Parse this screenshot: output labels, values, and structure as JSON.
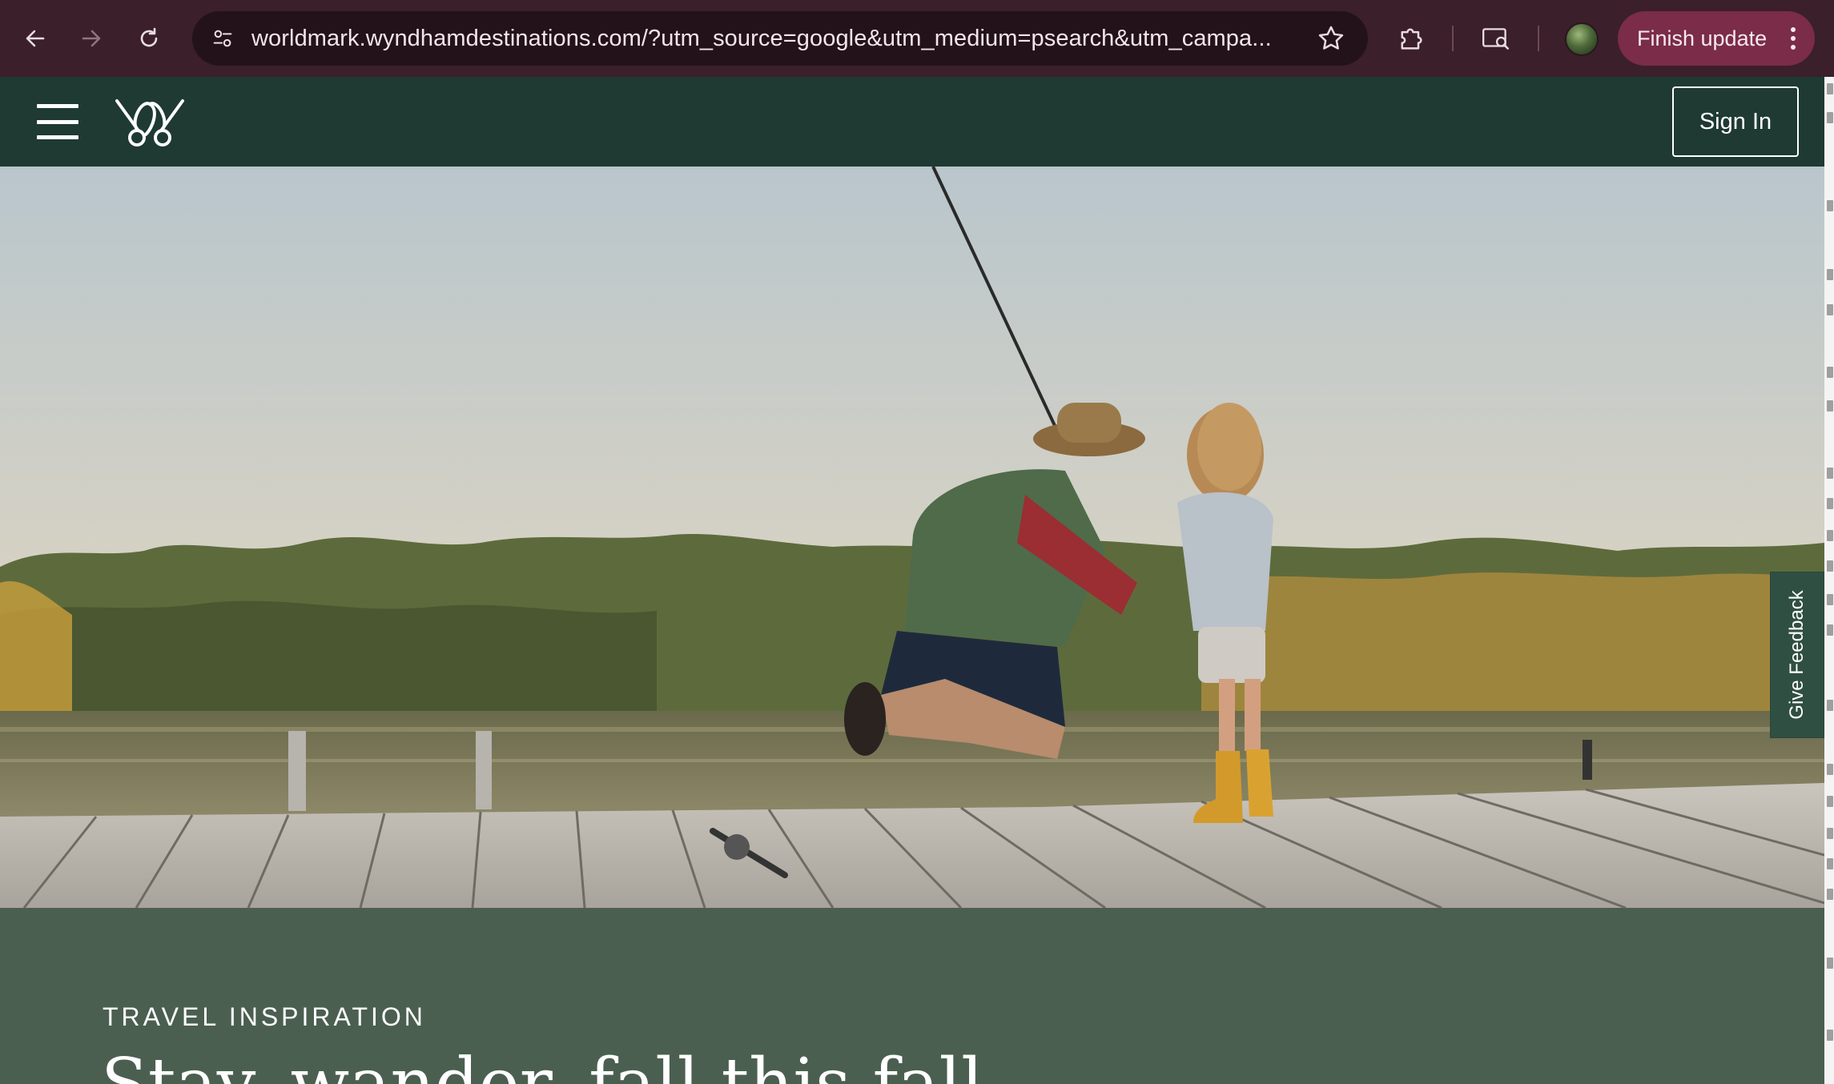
{
  "browser": {
    "url": "worldmark.wyndhamdestinations.com/?utm_source=google&utm_medium=psearch&utm_campa...",
    "finish_update_label": "Finish update",
    "icons": {
      "back": "arrow-left-icon",
      "forward": "arrow-right-icon",
      "reload": "reload-icon",
      "site_info": "tune-icon",
      "bookmark": "star-icon",
      "extensions": "puzzle-icon",
      "lens": "search-screen-icon",
      "menu": "kebab-menu-icon"
    },
    "colors": {
      "frame": "#3b1f2b",
      "omnibox": "#24121a",
      "finish_button": "#7a2c48"
    }
  },
  "site": {
    "header": {
      "sign_in_label": "Sign In",
      "menu_icon": "hamburger-icon",
      "logo_icon": "worldmark-logo-icon"
    },
    "hero": {
      "image_alt": "Man and child fishing on a wooden dock by a lake in autumn"
    },
    "section": {
      "eyebrow": "TRAVEL INSPIRATION",
      "headline": "Stay, wander, fall this fall"
    },
    "feedback_tab": "Give Feedback",
    "colors": {
      "header": "#1e3a32",
      "section": "#4b5f51",
      "feedback": "#2f4f42"
    }
  }
}
